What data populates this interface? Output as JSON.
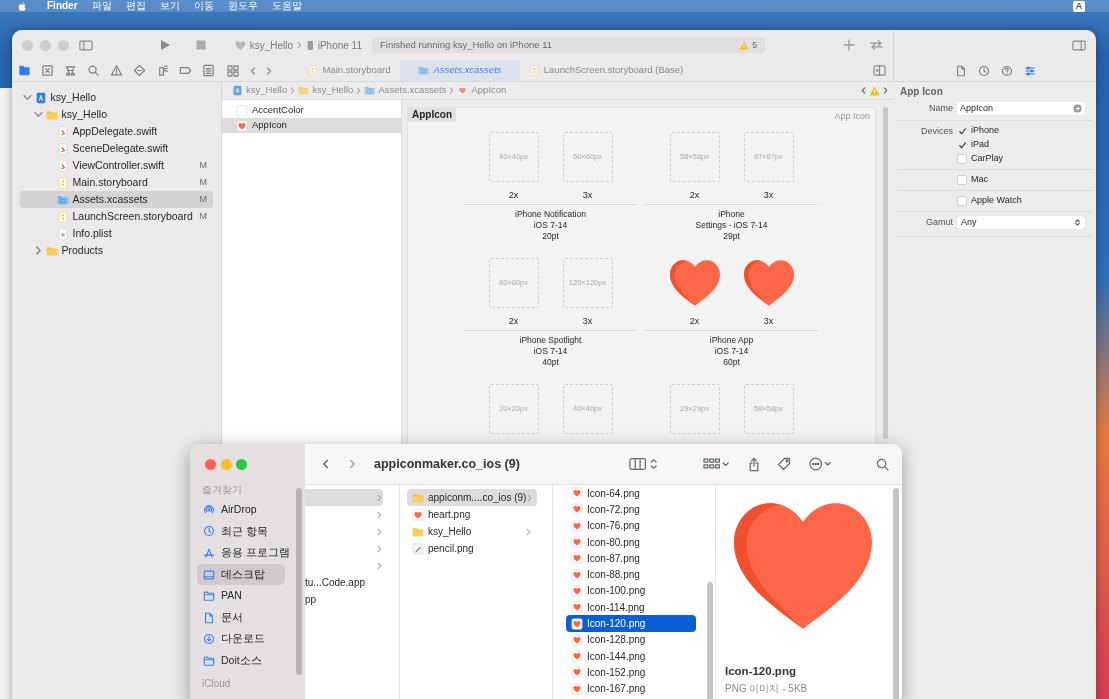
{
  "menu_bar": {
    "items": [
      {
        "label": "Finder",
        "kind": "app"
      },
      {
        "label": "파일",
        "kind": "menu"
      },
      {
        "label": "편집",
        "kind": "menu"
      },
      {
        "label": "보기",
        "kind": "menu"
      },
      {
        "label": "이동",
        "kind": "menu"
      },
      {
        "label": "윈도우",
        "kind": "menu"
      },
      {
        "label": "도움말",
        "kind": "menu"
      }
    ],
    "input_source": "A"
  },
  "xcode": {
    "scheme": {
      "project": "ksy_Hello",
      "device": "iPhone 11"
    },
    "status": "Finished running ksy_Hello on iPhone 11",
    "warning_count": "5",
    "navigator_tabs": [
      {
        "kind": "project",
        "selected": true
      },
      {
        "kind": "source-control",
        "selected": false
      },
      {
        "kind": "hierarchy",
        "selected": false
      },
      {
        "kind": "find",
        "selected": false
      },
      {
        "kind": "issues",
        "selected": false
      },
      {
        "kind": "tests",
        "selected": false
      },
      {
        "kind": "debug",
        "selected": false
      },
      {
        "kind": "breakpoints",
        "selected": false
      },
      {
        "kind": "reports",
        "selected": false
      }
    ],
    "tabs": [
      {
        "label": "Main.storyboard",
        "kind": "storyboard",
        "selected": false
      },
      {
        "label": "Assets.xcassets",
        "kind": "assets",
        "selected": true
      },
      {
        "label": "LaunchScreen.storyboard (Base)",
        "kind": "storyboard",
        "selected": false
      }
    ],
    "inspector_tabs": [
      {
        "kind": "file",
        "selected": false
      },
      {
        "kind": "history",
        "selected": false
      },
      {
        "kind": "help",
        "selected": false
      },
      {
        "kind": "attributes",
        "selected": true
      }
    ],
    "navigator": [
      {
        "label": "ksy_Hello",
        "kind": "project",
        "expanded": true,
        "selected": false,
        "children": [
          {
            "label": "ksy_Hello",
            "kind": "folder",
            "expanded": true,
            "selected": false,
            "children": [
              {
                "label": "AppDelegate.swift",
                "kind": "swift",
                "selected": false
              },
              {
                "label": "SceneDelegate.swift",
                "kind": "swift",
                "selected": false
              },
              {
                "label": "ViewController.swift",
                "kind": "swift",
                "status": "M",
                "selected": false
              },
              {
                "label": "Main.storyboard",
                "kind": "storyboard",
                "status": "M",
                "selected": false
              },
              {
                "label": "Assets.xcassets",
                "kind": "assets",
                "status": "M",
                "selected": true
              },
              {
                "label": "LaunchScreen.storyboard",
                "kind": "storyboard",
                "status": "M",
                "selected": false
              },
              {
                "label": "Info.plist",
                "kind": "plist",
                "selected": false
              }
            ]
          },
          {
            "label": "Products",
            "kind": "folder",
            "expanded": false,
            "selected": false
          }
        ]
      }
    ],
    "breadcrumb": [
      {
        "label": "ksy_Hello",
        "kind": "project"
      },
      {
        "label": "ksy_Hello",
        "kind": "folder"
      },
      {
        "label": "Assets.xcassets",
        "kind": "assets"
      },
      {
        "label": "AppIcon",
        "kind": "appicon"
      }
    ],
    "asset_list": [
      {
        "label": "AccentColor",
        "kind": "color",
        "selected": false
      },
      {
        "label": "AppIcon",
        "kind": "appicon",
        "selected": true
      }
    ],
    "asset_editor": {
      "title": "AppIcon",
      "type_label": "App Icon",
      "groups": [
        {
          "slots": [
            {
              "size": "40×40px",
              "scale": "2x",
              "filled": false
            },
            {
              "size": "60×60px",
              "scale": "3x",
              "filled": false
            }
          ],
          "caption": [
            "iPhone Notification",
            "iOS 7-14",
            "20pt"
          ]
        },
        {
          "slots": [
            {
              "size": "58×58px",
              "scale": "2x",
              "filled": false
            },
            {
              "size": "87×87px",
              "scale": "3x",
              "filled": false
            }
          ],
          "caption": [
            "iPhone",
            "Settings - iOS 7-14",
            "29pt"
          ]
        },
        {
          "slots": [
            {
              "size": "80×80px",
              "scale": "2x",
              "filled": false
            },
            {
              "size": "120×120px",
              "scale": "3x",
              "filled": false
            }
          ],
          "caption": [
            "iPhone Spotlight",
            "iOS 7-14",
            "40pt"
          ]
        },
        {
          "slots": [
            {
              "scale": "2x",
              "filled": true
            },
            {
              "scale": "3x",
              "filled": true
            }
          ],
          "caption": [
            "iPhone App",
            "iOS 7-14",
            "60pt"
          ]
        },
        {
          "slots": [
            {
              "size": "20×20px",
              "filled": false
            },
            {
              "size": "40×40px",
              "filled": false
            }
          ]
        },
        {
          "slots": [
            {
              "size": "29×29px",
              "filled": false
            },
            {
              "size": "58×58px",
              "filled": false
            }
          ]
        }
      ]
    },
    "inspector": {
      "title": "App Icon",
      "name_label": "Name",
      "name_value": "AppIcon",
      "devices_label": "Devices",
      "device_groups": [
        {
          "devices": [
            {
              "label": "iPhone",
              "checked": true
            },
            {
              "label": "iPad",
              "checked": true
            },
            {
              "label": "CarPlay",
              "checked": false
            }
          ]
        },
        {
          "devices": [
            {
              "label": "Mac",
              "checked": false
            }
          ]
        },
        {
          "devices": [
            {
              "label": "Apple Watch",
              "checked": false
            }
          ]
        }
      ],
      "gamut_label": "Gamut",
      "gamut_value": "Any"
    }
  },
  "finder": {
    "title": "appiconmaker.co_ios (9)",
    "sidebar": [
      {
        "header": "즐겨찾기",
        "items": [
          {
            "label": "AirDrop",
            "kind": "airdrop",
            "selected": false
          },
          {
            "label": "최근 항목",
            "kind": "recent",
            "selected": false
          },
          {
            "label": "응용 프로그램",
            "kind": "apps",
            "selected": false
          },
          {
            "label": "데스크탑",
            "kind": "desktop",
            "selected": true
          },
          {
            "label": "PAN",
            "kind": "folder",
            "selected": false
          },
          {
            "label": "문서",
            "kind": "document",
            "selected": false
          },
          {
            "label": "다운로드",
            "kind": "download",
            "selected": false
          },
          {
            "label": "Doit소스",
            "kind": "folder",
            "selected": false
          }
        ]
      },
      {
        "header": "iCloud"
      }
    ],
    "columns": [
      {
        "focused": false,
        "rows": [
          {
            "has_children": true,
            "selected": true
          },
          {
            "has_children": true,
            "selected": false
          },
          {
            "has_children": true,
            "selected": false
          },
          {
            "has_children": true,
            "selected": false
          },
          {
            "has_children": true,
            "selected": false
          },
          {
            "label": "tu...Code.app",
            "selected": false
          },
          {
            "label": "pp",
            "selected": false
          }
        ]
      },
      {
        "focused": false,
        "rows": [
          {
            "label": "appiconm....co_ios (9)",
            "kind": "folder",
            "has_children": true,
            "selected": true
          },
          {
            "label": "heart.png",
            "kind": "heart",
            "selected": false
          },
          {
            "label": "ksy_Hello",
            "kind": "folder",
            "has_children": true,
            "selected": false
          },
          {
            "label": "pencil.png",
            "kind": "pencil",
            "selected": false
          }
        ]
      },
      {
        "focused": true,
        "rows": [
          {
            "label": "Icon-64.png",
            "kind": "heart",
            "selected": false
          },
          {
            "label": "Icon-72.png",
            "kind": "heart",
            "selected": false
          },
          {
            "label": "Icon-76.png",
            "kind": "heart",
            "selected": false
          },
          {
            "label": "Icon-80.png",
            "kind": "heart",
            "selected": false
          },
          {
            "label": "Icon-87.png",
            "kind": "heart",
            "selected": false
          },
          {
            "label": "Icon-88.png",
            "kind": "heart",
            "selected": false
          },
          {
            "label": "Icon-100.png",
            "kind": "heart",
            "selected": false
          },
          {
            "label": "Icon-114.png",
            "kind": "heart",
            "selected": false
          },
          {
            "label": "Icon-120.png",
            "kind": "heart",
            "selected": true
          },
          {
            "label": "Icon-128.png",
            "kind": "heart",
            "selected": false
          },
          {
            "label": "Icon-144.png",
            "kind": "heart",
            "selected": false
          },
          {
            "label": "Icon-152.png",
            "kind": "heart",
            "selected": false
          },
          {
            "label": "Icon-167.png",
            "kind": "heart",
            "selected": false
          }
        ]
      }
    ],
    "preview": {
      "name": "Icon-120.png",
      "info": "PNG 이미지 - 5KB"
    }
  }
}
